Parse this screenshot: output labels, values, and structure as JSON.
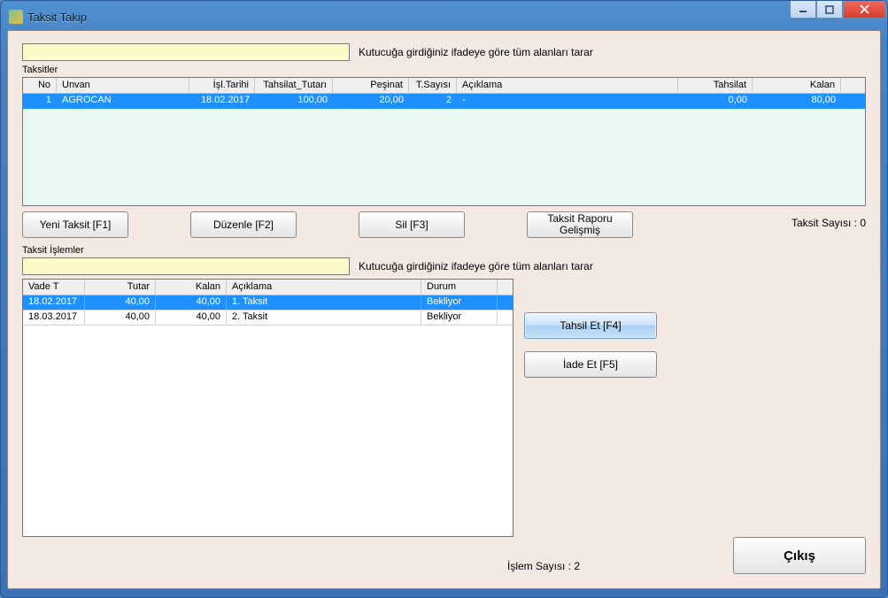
{
  "window": {
    "title": "Taksit Takip"
  },
  "search_main": {
    "value": "",
    "hint": "Kutucuğa girdiğiniz ifadeye göre tüm alanları tarar"
  },
  "taksitler": {
    "label": "Taksitler",
    "headers": {
      "no": "No",
      "unvan": "Unvan",
      "isl_tarihi": "İşl.Tarihi",
      "tahsilat_tutari": "Tahsilat_Tutarı",
      "pesinat": "Peşinat",
      "t_sayisi": "T.Sayısı",
      "aciklama": "Açıklama",
      "tahsilat": "Tahsilat",
      "kalan": "Kalan"
    },
    "rows": [
      {
        "no": "1",
        "unvan": "AGROCAN",
        "isl_tarihi": "18.02.2017",
        "tahsilat_tutari": "100,00",
        "pesinat": "20,00",
        "t_sayisi": "2",
        "aciklama": "-",
        "tahsilat": "0,00",
        "kalan": "80,00"
      }
    ],
    "count_label": "Taksit Sayısı : 0"
  },
  "buttons": {
    "yeni": "Yeni Taksit [F1]",
    "duzenle": "Düzenle [F2]",
    "sil": "Sil [F3]",
    "rapor": "Taksit Raporu Gelişmiş",
    "tahsil": "Tahsil Et [F4]",
    "iade": "İade Et [F5]",
    "cikis": "Çıkış"
  },
  "islemler": {
    "label": "Taksit İşlemler",
    "search_value": "",
    "search_hint": "Kutucuğa girdiğiniz ifadeye göre tüm alanları tarar",
    "headers": {
      "vade": "Vade T",
      "tutar": "Tutar",
      "kalan": "Kalan",
      "aciklama": "Açıklama",
      "durum": "Durum"
    },
    "rows": [
      {
        "vade": "18.02.2017",
        "tutar": "40,00",
        "kalan": "40,00",
        "aciklama": "1. Taksit",
        "durum": "Bekliyor"
      },
      {
        "vade": "18.03.2017",
        "tutar": "40,00",
        "kalan": "40,00",
        "aciklama": "2. Taksit",
        "durum": "Bekliyor"
      }
    ],
    "count_label": "İşlem Sayısı : 2"
  }
}
